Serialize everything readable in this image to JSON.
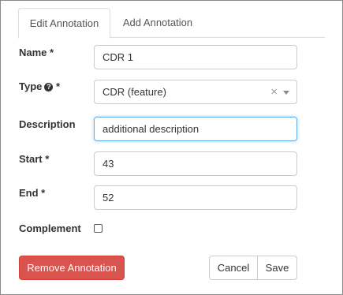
{
  "tabs": [
    {
      "label": "Edit Annotation",
      "active": true
    },
    {
      "label": "Add Annotation",
      "active": false
    }
  ],
  "form": {
    "name": {
      "label": "Name *",
      "value": "CDR 1"
    },
    "type": {
      "label": "Type",
      "required_mark": "*",
      "help_icon": "question-circle-icon",
      "value": "CDR (feature)",
      "clear_glyph": "×"
    },
    "description": {
      "label": "Description",
      "value": "additional description"
    },
    "start": {
      "label": "Start *",
      "value": "43"
    },
    "end": {
      "label": "End *",
      "value": "52"
    },
    "complement": {
      "label": "Complement",
      "checked": false
    }
  },
  "buttons": {
    "remove": "Remove Annotation",
    "cancel": "Cancel",
    "save": "Save"
  },
  "colors": {
    "danger": "#d9534f",
    "focus_border": "#66afe9"
  }
}
